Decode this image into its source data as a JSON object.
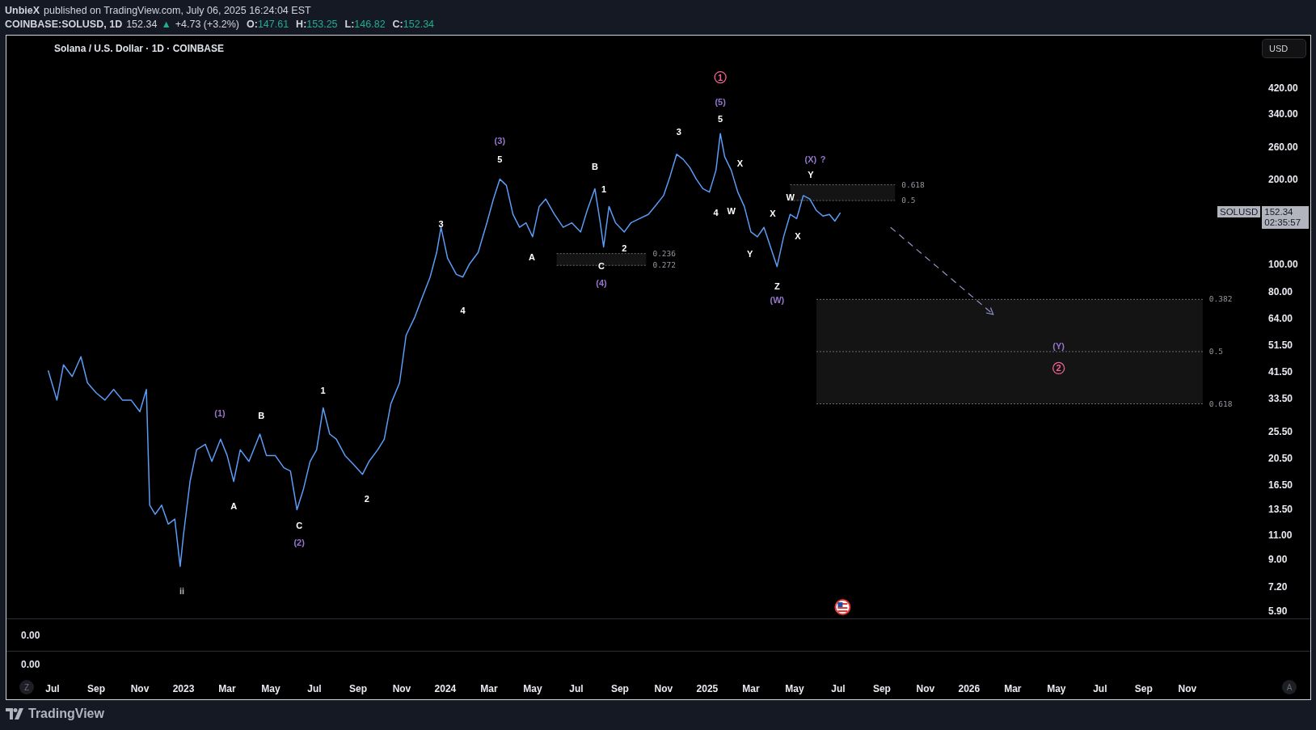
{
  "header": {
    "author": "UnbieX",
    "published": "published on TradingView.com, July 06, 2025 16:24:04 EST",
    "symbol": "COINBASE:SOLUSD, 1D",
    "price": "152.34",
    "change_icon": "▲",
    "change": "+4.73 (+3.2%)",
    "ohlc": [
      {
        "label": "O:",
        "value": "147.61"
      },
      {
        "label": "H:",
        "value": "153.25"
      },
      {
        "label": "L:",
        "value": "146.82"
      },
      {
        "label": "C:",
        "value": "152.34"
      }
    ]
  },
  "chart": {
    "legend": "Solana / U.S. Dollar · 1D · COINBASE",
    "currency_button": "USD",
    "price_tag": {
      "symbol": "SOLUSD",
      "price": "152.34",
      "countdown": "02:35:57"
    },
    "price_axis_labels": [
      "420.00",
      "340.00",
      "260.00",
      "200.00",
      "100.00",
      "80.00",
      "64.00",
      "51.50",
      "41.50",
      "33.50",
      "25.50",
      "20.50",
      "16.50",
      "13.50",
      "11.00",
      "9.00",
      "7.20",
      "5.90"
    ],
    "time_axis_labels": [
      "Jul",
      "Sep",
      "Nov",
      "2023",
      "Mar",
      "May",
      "Jul",
      "Sep",
      "Nov",
      "2024",
      "Mar",
      "May",
      "Jul",
      "Sep",
      "Nov",
      "2025",
      "Mar",
      "May",
      "Jul",
      "Sep",
      "Nov",
      "2026",
      "Mar",
      "May",
      "Jul",
      "Sep",
      "Nov"
    ],
    "wave_labels": [
      {
        "text": "ii",
        "color": "#b2b5be",
        "kind": "label"
      },
      {
        "text": "(1)",
        "color": "#9575cd",
        "kind": "label"
      },
      {
        "text": "B",
        "color": "#ffffff",
        "kind": "label"
      },
      {
        "text": "A",
        "color": "#ffffff",
        "kind": "label"
      },
      {
        "text": "1",
        "color": "#ffffff",
        "kind": "label"
      },
      {
        "text": "C",
        "color": "#ffffff",
        "kind": "label"
      },
      {
        "text": "(2)",
        "color": "#9575cd",
        "kind": "label"
      },
      {
        "text": "2",
        "color": "#ffffff",
        "kind": "label"
      },
      {
        "text": "3",
        "color": "#ffffff",
        "kind": "label"
      },
      {
        "text": "4",
        "color": "#ffffff",
        "kind": "label"
      },
      {
        "text": "(3)",
        "color": "#9575cd",
        "kind": "label"
      },
      {
        "text": "5",
        "color": "#ffffff",
        "kind": "label"
      },
      {
        "text": "A",
        "color": "#ffffff",
        "kind": "label"
      },
      {
        "text": "B",
        "color": "#ffffff",
        "kind": "label"
      },
      {
        "text": "1",
        "color": "#ffffff",
        "kind": "label"
      },
      {
        "text": "2",
        "color": "#ffffff",
        "kind": "label"
      },
      {
        "text": "C",
        "color": "#ffffff",
        "kind": "label"
      },
      {
        "text": "(4)",
        "color": "#9575cd",
        "kind": "label"
      },
      {
        "text": "3",
        "color": "#ffffff",
        "kind": "label"
      },
      {
        "text": "1",
        "color": "#f06292",
        "kind": "circled"
      },
      {
        "text": "(5)",
        "color": "#9575cd",
        "kind": "label"
      },
      {
        "text": "5",
        "color": "#ffffff",
        "kind": "label"
      },
      {
        "text": "4",
        "color": "#ffffff",
        "kind": "label"
      },
      {
        "text": "X",
        "color": "#ffffff",
        "kind": "label"
      },
      {
        "text": "W",
        "color": "#ffffff",
        "kind": "label"
      },
      {
        "text": "Y",
        "color": "#ffffff",
        "kind": "label"
      },
      {
        "text": "X",
        "color": "#ffffff",
        "kind": "label"
      },
      {
        "text": "Z",
        "color": "#ffffff",
        "kind": "label"
      },
      {
        "text": "(W)",
        "color": "#9575cd",
        "kind": "label"
      },
      {
        "text": "W",
        "color": "#ffffff",
        "kind": "label"
      },
      {
        "text": "X",
        "color": "#ffffff",
        "kind": "label"
      },
      {
        "text": "(X)",
        "color": "#9575cd",
        "kind": "label"
      },
      {
        "text": "?",
        "color": "#9575cd",
        "kind": "label"
      },
      {
        "text": "Y",
        "color": "#ffffff",
        "kind": "label"
      },
      {
        "text": "(Y)",
        "color": "#9575cd",
        "kind": "label"
      },
      {
        "text": "2",
        "color": "#f06292",
        "kind": "circled"
      }
    ],
    "fib_zones": [
      {
        "levels": [
          {
            "label": "0.236"
          },
          {
            "label": "0.272"
          }
        ]
      },
      {
        "levels": [
          {
            "label": "0.618"
          },
          {
            "label": "0.5"
          }
        ]
      },
      {
        "levels": [
          {
            "label": "0.382"
          },
          {
            "label": "0.5"
          },
          {
            "label": "0.618"
          }
        ]
      }
    ]
  },
  "sub_panes": [
    {
      "value": "0.00"
    },
    {
      "value": "0.00"
    }
  ],
  "scale_buttons": [
    {
      "label": "Z"
    },
    {
      "label": "A"
    }
  ],
  "footer": {
    "brand": "TradingView"
  }
}
